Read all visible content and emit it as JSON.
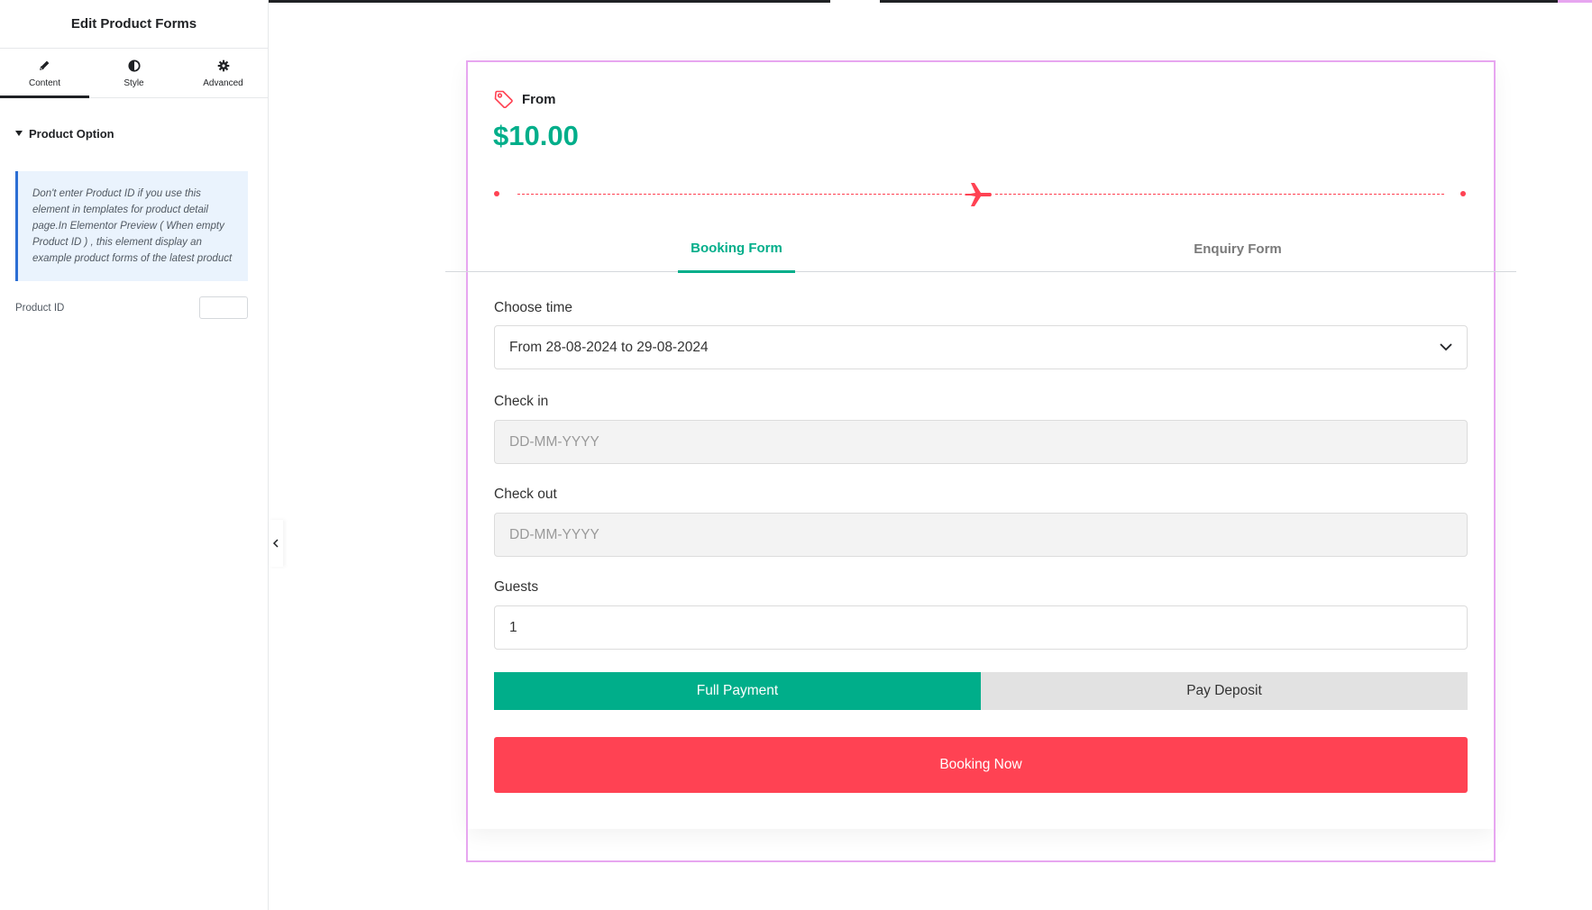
{
  "panel": {
    "title": "Edit Product Forms",
    "tabs": [
      {
        "label": "Content",
        "icon": "pencil-icon"
      },
      {
        "label": "Style",
        "icon": "contrast-icon"
      },
      {
        "label": "Advanced",
        "icon": "gear-icon"
      }
    ],
    "section_title": "Product Option",
    "notice": "Don't enter Product ID if you use this element in templates for product detail page.In Elementor Preview ( When empty Product ID ) , this element display an example product forms of the latest product",
    "product_id_label": "Product ID",
    "product_id_value": ""
  },
  "widget": {
    "price_label": "From",
    "price_value": "$10.00",
    "tabs": {
      "booking": "Booking Form",
      "enquiry": "Enquiry Form"
    },
    "fields": {
      "choose_time": {
        "label": "Choose time",
        "value": "From 28-08-2024 to 29-08-2024"
      },
      "check_in": {
        "label": "Check in",
        "placeholder": "DD-MM-YYYY"
      },
      "check_out": {
        "label": "Check out",
        "placeholder": "DD-MM-YYYY"
      },
      "guests": {
        "label": "Guests",
        "value": "1"
      }
    },
    "payment": {
      "full": "Full Payment",
      "deposit": "Pay Deposit",
      "selected": "Full Payment"
    },
    "submit": "Booking Now"
  },
  "colors": {
    "accent_green": "#00ae8a",
    "accent_red": "#ff4253",
    "notice_border": "#2b6ed4",
    "widget_outline": "#e7a6f0"
  }
}
